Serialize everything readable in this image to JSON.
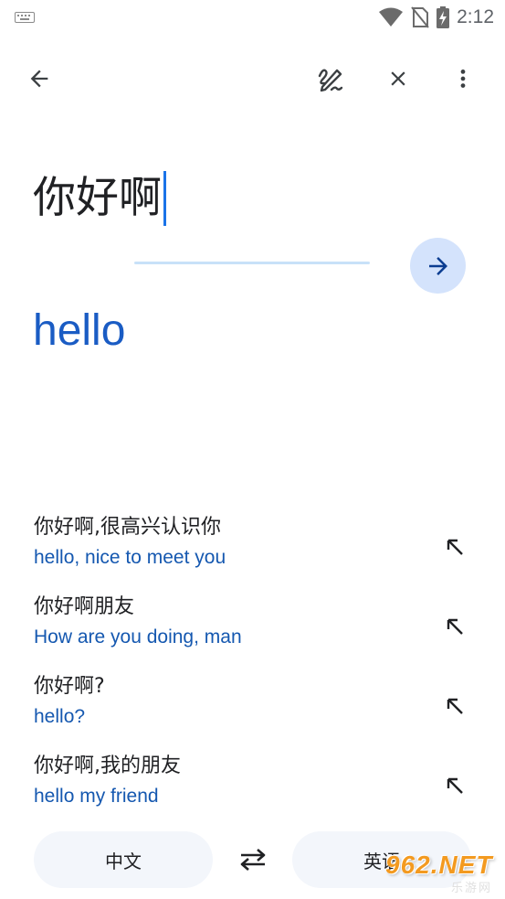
{
  "status_bar": {
    "time": "2:12",
    "icons": [
      "keyboard-icon",
      "wifi-icon",
      "no-sim-icon",
      "battery-charging-icon"
    ]
  },
  "toolbar": {
    "back_icon": "arrow-back-icon",
    "handwriting_icon": "handwriting-icon",
    "clear_icon": "close-icon",
    "more_icon": "more-vert-icon"
  },
  "input": {
    "source_text": "你好啊"
  },
  "result": {
    "translation": "hello"
  },
  "suggestions": [
    {
      "source": "你好啊,很高兴认识你",
      "target": "hello, nice to meet you"
    },
    {
      "source": "你好啊朋友",
      "target": "How are you doing, man"
    },
    {
      "source": "你好啊?",
      "target": "hello?"
    },
    {
      "source": "你好啊,我的朋友",
      "target": "hello my friend"
    }
  ],
  "languages": {
    "source": "中文",
    "target": "英语",
    "swap_icon": "swap-icon"
  },
  "watermark": {
    "main": "962.NET",
    "sub": "乐游网"
  },
  "colors": {
    "accent": "#1a73e8",
    "translation": "#1a5cc4",
    "submit_bg": "#d4e3fc",
    "lang_pill_bg": "#f3f6fb"
  }
}
